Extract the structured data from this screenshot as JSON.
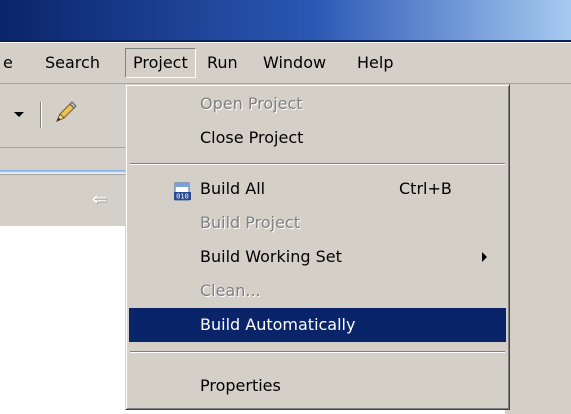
{
  "menubar": {
    "items": [
      {
        "label": "e"
      },
      {
        "label": "Search"
      },
      {
        "label": "Project"
      },
      {
        "label": "Run"
      },
      {
        "label": "Window"
      },
      {
        "label": "Help"
      }
    ]
  },
  "toolbar": {
    "dropdown_icon": "chevron-down-icon",
    "tool_icon": "pencil-icon"
  },
  "viewbar": {
    "back_icon": "back-arrow-icon",
    "back_glyph": "⇐"
  },
  "project_menu": {
    "items": [
      {
        "label": "Open Project"
      },
      {
        "label": "Close Project"
      },
      {
        "label": "Build All",
        "shortcut": "Ctrl+B",
        "icon": "build-all-icon"
      },
      {
        "label": "Build Project"
      },
      {
        "label": "Build Working Set"
      },
      {
        "label": "Clean..."
      },
      {
        "label": "Build Automatically"
      },
      {
        "label": "Properties"
      }
    ]
  },
  "colors": {
    "menu_background": "#d4d0c8",
    "selection": "#0a246a",
    "disabled_text": "#808080"
  }
}
